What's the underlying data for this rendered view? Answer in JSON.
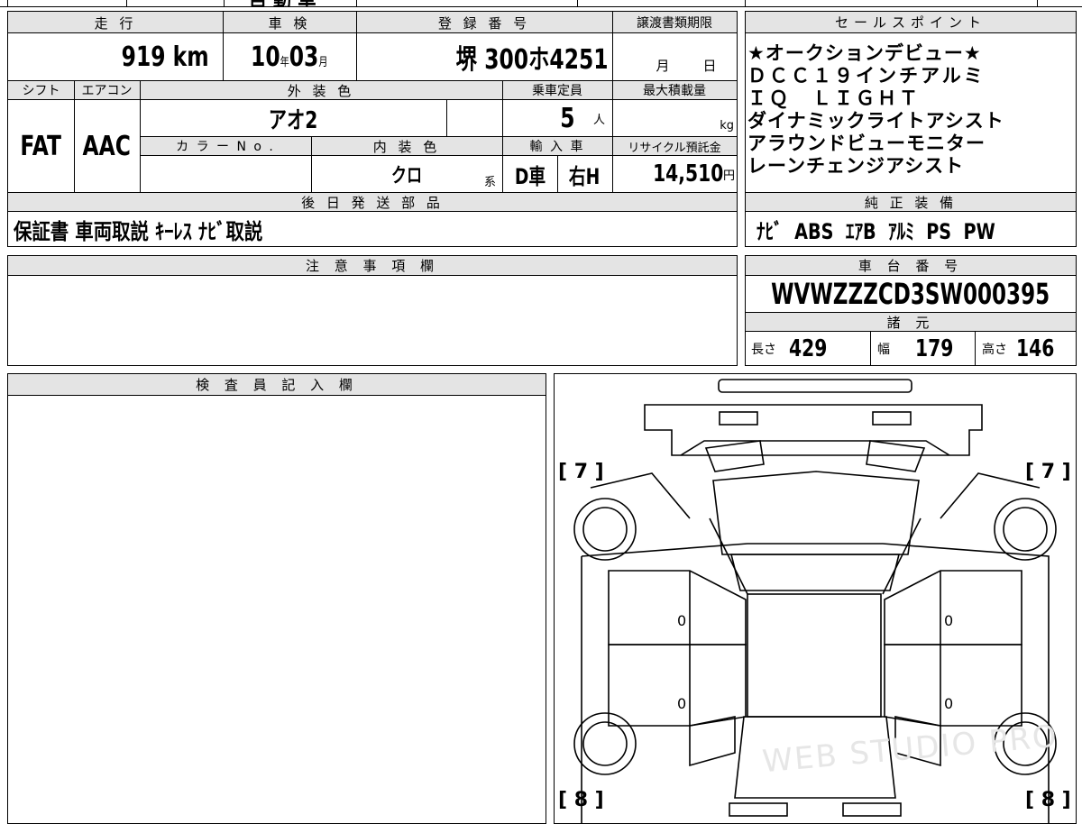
{
  "top_strip": "自 動 車",
  "main": {
    "headers": {
      "mileage": "走 行",
      "inspection": "車 検",
      "registration": "登 録 番 号",
      "transfer_deadline": "譲渡書類期限",
      "shift": "シフト",
      "aircon": "エアコン",
      "exterior_color": "外 装 色",
      "capacity": "乗車定員",
      "max_load": "最大積載量",
      "color_no": "カ ラ ー N o .",
      "interior_color": "内 装 色",
      "import": "輸 入 車",
      "recycle": "リサイクル預託金"
    },
    "mileage_value": "919",
    "mileage_unit": "km",
    "inspection_year": "10",
    "inspection_year_unit": "年",
    "inspection_month": "03",
    "inspection_month_unit": "月",
    "registration_value": "堺 300ホ4251",
    "transfer_month_unit": "月",
    "transfer_day_unit": "日",
    "shift_value": "FAT",
    "aircon_value": "AAC",
    "exterior_color_value": "アオ2",
    "capacity_value": "5",
    "capacity_unit": "人",
    "max_load_unit": "kg",
    "interior_color_value": "クロ",
    "interior_suffix": "系",
    "import_drive": "D車",
    "import_handle": "右H",
    "recycle_value": "14,510",
    "recycle_unit": "円"
  },
  "later_parts": {
    "header": "後 日 発 送 部 品",
    "items": "保証書 車両取説 ｷｰﾚｽ ﾅﾋﾞ取説"
  },
  "sales_points": {
    "header": "セールスポイント",
    "lines": [
      "★オークションデビュー★",
      "ＤＣＣ１９インチアルミ",
      "ＩＱ　ＬＩＧＨＴ",
      "ダイナミックライトアシスト",
      "アラウンドビューモニター",
      "レーンチェンジアシスト"
    ]
  },
  "genuine_equipment": {
    "header": "純 正 装 備",
    "items": "ﾅﾋﾞ  ABS  ｴｱB  ｱﾙﾐ  PS  PW"
  },
  "notes": {
    "header": "注 意 事 項 欄"
  },
  "chassis": {
    "header": "車 台 番 号",
    "value": "WVWZZZCD3SW000395"
  },
  "specs": {
    "header": "諸 元",
    "length_label": "長さ",
    "length_value": "429",
    "width_label": "幅",
    "width_value": "179",
    "height_label": "高さ",
    "height_value": "146"
  },
  "inspector": {
    "header": "検 査 員 記 入 欄"
  },
  "diagram": {
    "front_left": "[ 7 ]",
    "front_right": "[ 7 ]",
    "rear_left": "[ 8 ]",
    "rear_right": "[ 8 ]",
    "door_marks": [
      "0",
      "0",
      "0",
      "0"
    ],
    "watermark": "WEB STUDIO PRO"
  }
}
